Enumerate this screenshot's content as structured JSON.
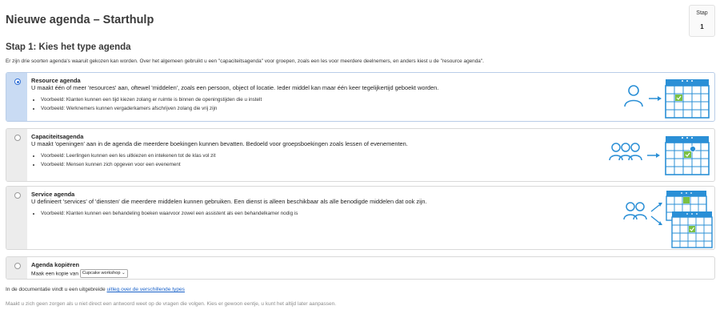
{
  "page": {
    "title": "Nieuwe agenda – Starthulp",
    "step_label": "Stap",
    "step_number": "1"
  },
  "step": {
    "title": "Stap 1: Kies het type agenda",
    "intro": "Er zijn drie soorten agenda's waaruit gekozen kan worden. Over het algemeen gebruikt u een \"capaciteitsagenda\" voor groepen, zoals een les voor meerdere deelnemers, en anders kiest u de \"resource agenda\"."
  },
  "options": [
    {
      "title": "Resource agenda",
      "description": "U maakt één of meer 'resources' aan, oftewel 'middelen', zoals een persoon, object of locatie. Ieder middel kan maar één keer tegelijkertijd geboekt worden.",
      "examples": [
        "Voorbeeld: Klanten kunnen een tijd kiezen zolang er ruimte is binnen de openingstijden die u instelt",
        "Voorbeeld: Werknemers kunnen vergaderkamers afschrijven zolang die vrij zijn"
      ],
      "selected": true
    },
    {
      "title": "Capaciteitsagenda",
      "description": "U maakt 'openingen' aan in de agenda die meerdere boekingen kunnen bevatten. Bedoeld voor groepsboekingen zoals lessen of evenementen.",
      "examples": [
        "Voorbeeld: Leerlingen kunnen een les uitkiezen en intekenen tot de klas vol zit",
        "Voorbeeld: Mensen kunnen zich opgeven voor een evenement"
      ],
      "selected": false
    },
    {
      "title": "Service agenda",
      "description": "U definieert 'services' of 'diensten' die meerdere middelen kunnen gebruiken. Een dienst is alleen beschikbaar als alle benodigde middelen dat ook zijn.",
      "examples": [
        "Voorbeeld: Klanten kunnen een behandeling boeken waarvoor zowel een assistent als een behandelkamer nodig is"
      ],
      "selected": false
    }
  ],
  "copy_option": {
    "title": "Agenda kopiëren",
    "prefix": "Maak een kopie van",
    "selected_value": "Cupcake workshop"
  },
  "footer": {
    "doc_prefix": "In de documentatie vindt u een uitgebreide ",
    "doc_link": "uitleg over de verschillende types",
    "hint": "Maakt u zich geen zorgen als u niet direct een antwoord weet op de vragen die volgen. Kies er gewoon eentje, u kunt het altijd later aanpassen."
  },
  "colors": {
    "accent_blue": "#2a8fd6",
    "check_green": "#7bc142",
    "selected_rail": "#c9dbf3"
  },
  "icons": [
    "person-icon",
    "group-icon",
    "calendar-icon",
    "check-icon",
    "arrow-icon"
  ]
}
